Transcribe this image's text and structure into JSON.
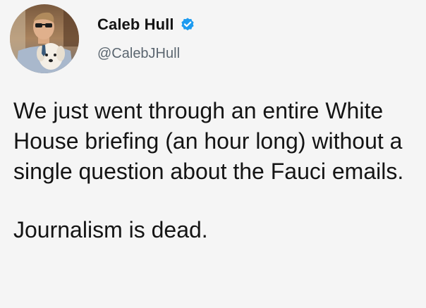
{
  "tweet": {
    "author": {
      "display_name": "Caleb Hull",
      "handle": "@CalebJHull",
      "verified_icon": "verified-badge-icon",
      "avatar": "profile-photo-with-dog"
    },
    "text": {
      "paragraph_1": "We just went through an entire White House briefing (an hour long) without a single question about the Fauci emails.",
      "paragraph_2": "Journalism is dead."
    },
    "colors": {
      "background": "#f5f5f5",
      "verified_blue": "#1d9bf0",
      "handle_gray": "#5b6670"
    }
  }
}
